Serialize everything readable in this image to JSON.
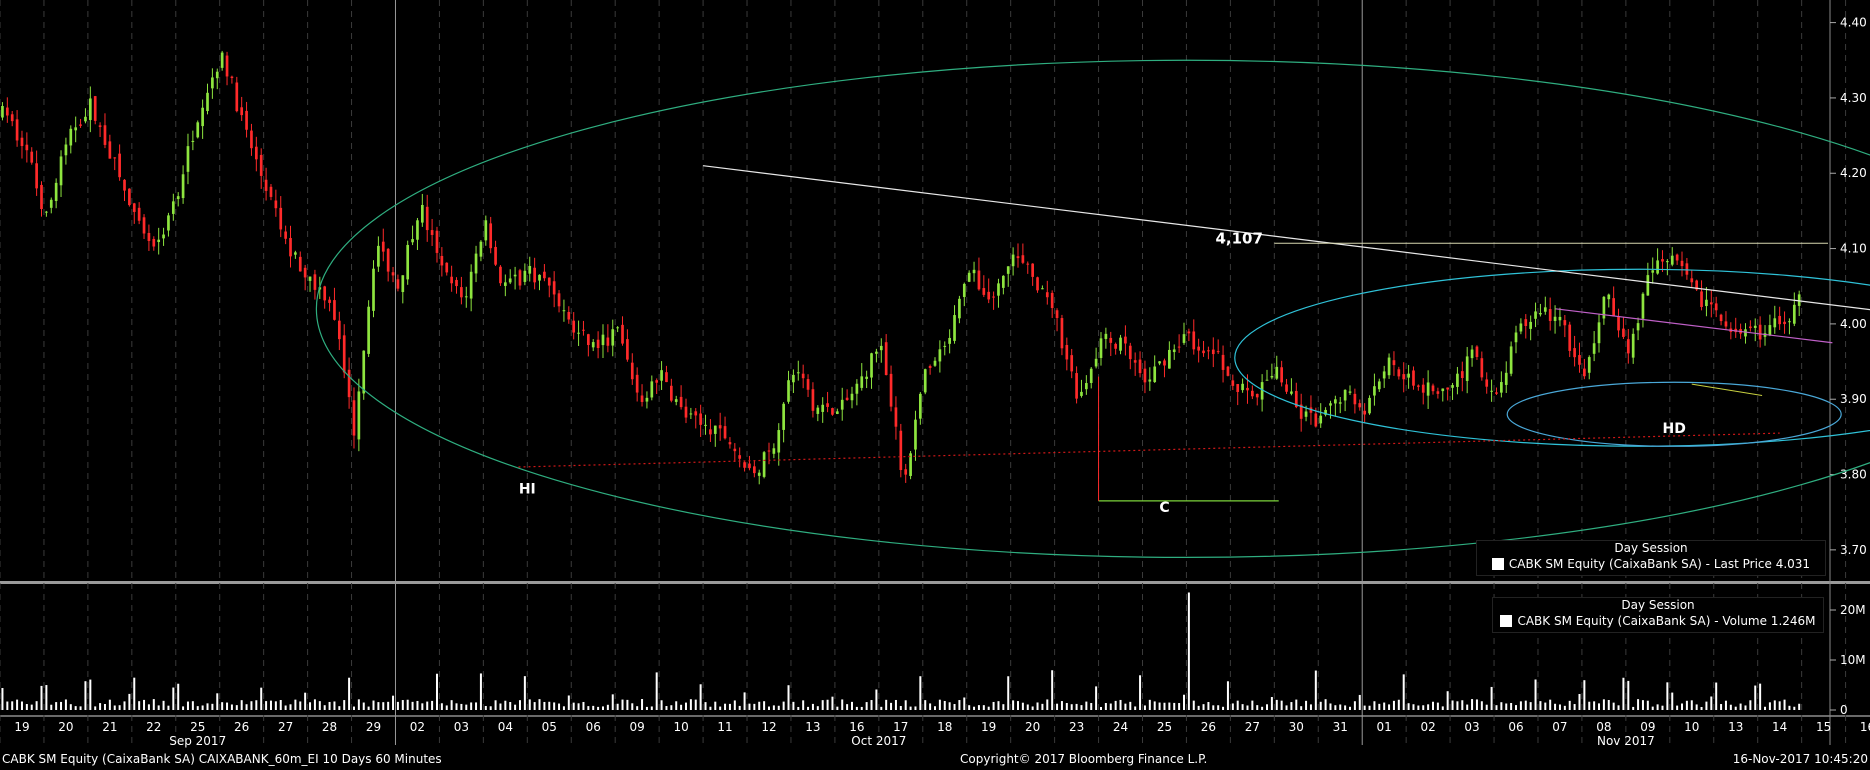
{
  "colors": {
    "background": "#000000",
    "up": "#8ee53f",
    "down": "#ff2a2a",
    "grid": "#3a3a3a",
    "ellipse_outer": "#2fae80",
    "ellipse_mid": "#2fc2d8",
    "ellipse_inner": "#4aa8d8",
    "trendline": "#e8e8e8",
    "support_dotted": "#d01818",
    "level_line": "#d8d8b0",
    "c_line": "#7bd23a",
    "purple_line": "#c060c8",
    "volume_bar": "#ffffff"
  },
  "footer": {
    "left": "CABK SM Equity (CaixaBank SA) CAIXABANK_60m_EI 10 Days 60 Minutes",
    "center": "Copyright© 2017 Bloomberg Finance L.P.",
    "right": "16-Nov-2017 10:45:20"
  },
  "legend_price": {
    "title": "Day Session",
    "label": "CABK SM Equity (CaixaBank SA) - Last Price 4.031"
  },
  "legend_volume": {
    "title": "Day Session",
    "label": "CABK SM Equity (CaixaBank SA) - Volume 1.246M"
  },
  "chart_data": [
    {
      "type": "candlestick",
      "title": "",
      "y_axis": {
        "side": "right",
        "ylim": [
          3.66,
          4.43
        ],
        "ticks": [
          "4.40",
          "4.30",
          "4.20",
          "4.10",
          "4.00",
          "3.90",
          "3.80",
          "3.70"
        ]
      },
      "x_axis": {
        "tick_labels": [
          "19",
          "20",
          "21",
          "22",
          "25",
          "26",
          "27",
          "28",
          "29",
          "02",
          "03",
          "04",
          "05",
          "06",
          "09",
          "10",
          "11",
          "12",
          "13",
          "16",
          "17",
          "18",
          "19",
          "20",
          "23",
          "24",
          "25",
          "26",
          "27",
          "30",
          "31",
          "01",
          "02",
          "03",
          "06",
          "07",
          "08",
          "09",
          "10",
          "13",
          "14",
          "15",
          "16"
        ],
        "month_labels": [
          {
            "label": "Sep 2017",
            "day_index": 4
          },
          {
            "label": "Oct 2017",
            "day_index": 19.5
          },
          {
            "label": "Nov 2017",
            "day_index": 36.5
          }
        ],
        "month_separators": [
          9,
          31
        ],
        "visible_days": 41.6
      },
      "series": [
        {
          "name": "Last Price",
          "x": [
            0,
            0.5,
            1,
            1.5,
            2,
            2.5,
            3,
            3.5,
            4,
            4.5,
            5,
            5.5,
            6,
            6.5,
            7,
            7.5,
            8,
            8.5,
            9,
            9.5,
            10,
            10.5,
            11,
            11.3,
            11.5,
            12,
            12.5,
            13,
            13.5,
            14,
            14.5,
            15,
            15.5,
            16,
            16.5,
            17,
            17.5,
            18,
            18.5,
            19,
            19.5,
            20,
            20.5,
            21,
            21.5,
            22,
            22.5,
            23,
            23.5,
            24,
            24.5,
            25,
            25.5,
            26,
            26.5,
            27,
            27.3,
            27.5,
            28,
            28.5,
            29,
            29.5,
            30,
            30.5,
            31,
            31.5,
            32,
            32.5,
            33,
            33.5,
            34,
            34.5,
            35,
            35.5,
            36,
            36.5,
            37,
            37.5,
            38,
            38.5,
            39,
            39.5,
            40,
            40.5,
            40.9
          ],
          "values": [
            4.28,
            4.24,
            4.14,
            4.25,
            4.29,
            4.22,
            4.14,
            4.1,
            4.18,
            4.29,
            4.36,
            4.26,
            4.18,
            4.1,
            4.06,
            4.03,
            3.86,
            4.11,
            4.05,
            4.16,
            4.07,
            4.03,
            4.14,
            4.06,
            4.05,
            4.07,
            4.05,
            3.99,
            3.97,
            3.99,
            3.9,
            3.93,
            3.88,
            3.86,
            3.85,
            3.8,
            3.83,
            3.94,
            3.89,
            3.88,
            3.92,
            3.98,
            3.79,
            3.93,
            3.97,
            4.07,
            4.03,
            4.09,
            4.06,
            4.0,
            3.9,
            3.98,
            3.97,
            3.92,
            3.96,
            3.99,
            3.95,
            3.97,
            3.92,
            3.9,
            3.94,
            3.88,
            3.87,
            3.91,
            3.89,
            3.95,
            3.93,
            3.91,
            3.92,
            3.96,
            3.9,
            3.99,
            4.02,
            4.0,
            3.92,
            4.05,
            3.96,
            4.07,
            4.09,
            4.04,
            4.02,
            3.98,
            3.99,
            4.0,
            4.031
          ]
        }
      ],
      "annotations": [
        {
          "text": "4,107",
          "x": 27.7,
          "y": 4.107
        },
        {
          "text": "HI",
          "x": 11.5,
          "y": 3.775
        },
        {
          "text": "C",
          "x": 26.0,
          "y": 3.75
        },
        {
          "text": "HD",
          "x": 37.6,
          "y": 3.855
        }
      ]
    },
    {
      "type": "bar",
      "title": "",
      "y_axis": {
        "side": "right",
        "ylim": [
          -1,
          25
        ],
        "ticks": [
          "20M",
          "10M",
          "0"
        ]
      },
      "series": [
        {
          "name": "Volume",
          "note": "hourly volume bars; notable spike on 26 Oct ~23M; last 1.246M"
        }
      ]
    }
  ]
}
